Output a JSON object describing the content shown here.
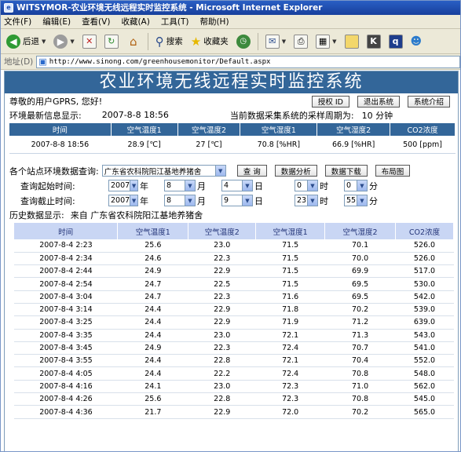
{
  "window": {
    "title": "WITSYMOR-农业环境无线远程实时监控系统 - Microsoft Internet Explorer"
  },
  "menu": [
    "文件(F)",
    "编辑(E)",
    "查看(V)",
    "收藏(A)",
    "工具(T)",
    "帮助(H)"
  ],
  "toolbar": {
    "back": "后退",
    "search": "搜索",
    "favorites": "收藏夹"
  },
  "address": {
    "label": "地址(D)",
    "url": "http://www.sinong.com/greenhousemonitor/Default.aspx"
  },
  "page": {
    "banner": "农业环境无线远程实时监控系统",
    "greeting": "尊敬的用户GPRS, 您好!",
    "buttons": {
      "authorize": "授权 ID",
      "logout": "退出系统",
      "intro": "系统介绍"
    },
    "latest_label": "环境最新信息显示:",
    "latest_time": "2007-8-8 18:56",
    "period_text": "当前数据采集系统的采样周期为:",
    "period_value": "10 分钟",
    "current_headers": [
      "时间",
      "空气温度1",
      "空气温度2",
      "空气湿度1",
      "空气湿度2",
      "CO2浓度"
    ],
    "current_row": [
      "2007-8-8 18:56",
      "28.9 [℃]",
      "27 [℃]",
      "70.8 [%HR]",
      "66.9 [%HR]",
      "500 [ppm]"
    ],
    "query": {
      "station_label": "各个站点环境数据查询:",
      "station_value": "广东省农科院阳江基地养猪舍",
      "btn_query": "查 询",
      "btn_analysis": "数据分析",
      "btn_download": "数据下载",
      "btn_layout": "布局图",
      "start_label": "查询起始时间:",
      "end_label": "查询截止时间:",
      "start": {
        "year": "2007",
        "month": "8",
        "day": "4",
        "hour": "0",
        "minute": "0"
      },
      "end": {
        "year": "2007",
        "month": "8",
        "day": "9",
        "hour": "23",
        "minute": "55"
      },
      "unit_year": "年",
      "unit_month": "月",
      "unit_day": "日",
      "unit_hour": "时",
      "unit_minute": "分"
    },
    "history_label": "历史数据显示:",
    "history_from": "来自 广东省农科院阳江基地养猪舍",
    "history_headers": [
      "时间",
      "空气温度1",
      "空气温度2",
      "空气湿度1",
      "空气湿度2",
      "CO2浓度"
    ],
    "history_rows": [
      [
        "2007-8-4 2:23",
        "25.6",
        "23.0",
        "71.5",
        "70.1",
        "526.0"
      ],
      [
        "2007-8-4 2:34",
        "24.6",
        "22.3",
        "71.5",
        "70.0",
        "526.0"
      ],
      [
        "2007-8-4 2:44",
        "24.9",
        "22.9",
        "71.5",
        "69.9",
        "517.0"
      ],
      [
        "2007-8-4 2:54",
        "24.7",
        "22.5",
        "71.5",
        "69.5",
        "530.0"
      ],
      [
        "2007-8-4 3:04",
        "24.7",
        "22.3",
        "71.6",
        "69.5",
        "542.0"
      ],
      [
        "2007-8-4 3:14",
        "24.4",
        "22.9",
        "71.8",
        "70.2",
        "539.0"
      ],
      [
        "2007-8-4 3:25",
        "24.4",
        "22.9",
        "71.9",
        "71.2",
        "639.0"
      ],
      [
        "2007-8-4 3:35",
        "24.4",
        "23.0",
        "72.1",
        "71.3",
        "543.0"
      ],
      [
        "2007-8-4 3:45",
        "24.9",
        "22.3",
        "72.4",
        "70.7",
        "541.0"
      ],
      [
        "2007-8-4 3:55",
        "24.4",
        "22.8",
        "72.1",
        "70.4",
        "552.0"
      ],
      [
        "2007-8-4 4:05",
        "24.4",
        "22.2",
        "72.4",
        "70.8",
        "548.0"
      ],
      [
        "2007-8-4 4:16",
        "24.1",
        "23.0",
        "72.3",
        "71.0",
        "562.0"
      ],
      [
        "2007-8-4 4:26",
        "25.6",
        "22.8",
        "72.3",
        "70.8",
        "545.0"
      ],
      [
        "2007-8-4 4:36",
        "21.7",
        "22.9",
        "72.0",
        "70.2",
        "565.0"
      ]
    ]
  }
}
